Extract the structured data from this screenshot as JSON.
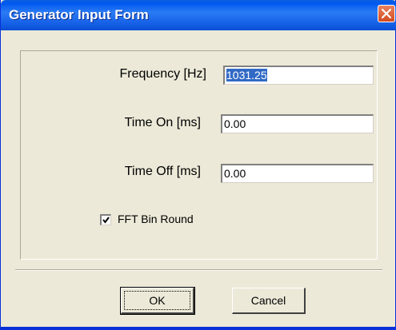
{
  "window": {
    "title": "Generator Input Form"
  },
  "form": {
    "frequency_label": "Frequency [Hz]",
    "frequency_value": "1031.25",
    "time_on_label": "Time On [ms]",
    "time_on_value": "0.00",
    "time_off_label": "Time Off [ms]",
    "time_off_value": "0.00",
    "fft_bin_round_label": "FFT Bin Round",
    "fft_bin_round_checked": true
  },
  "buttons": {
    "ok_label": "OK",
    "cancel_label": "Cancel"
  },
  "colors": {
    "title_bar": "#0a5fe0",
    "close_button": "#d44b1f",
    "selection_highlight": "#316ac5",
    "dialog_background": "#ece9d8"
  }
}
